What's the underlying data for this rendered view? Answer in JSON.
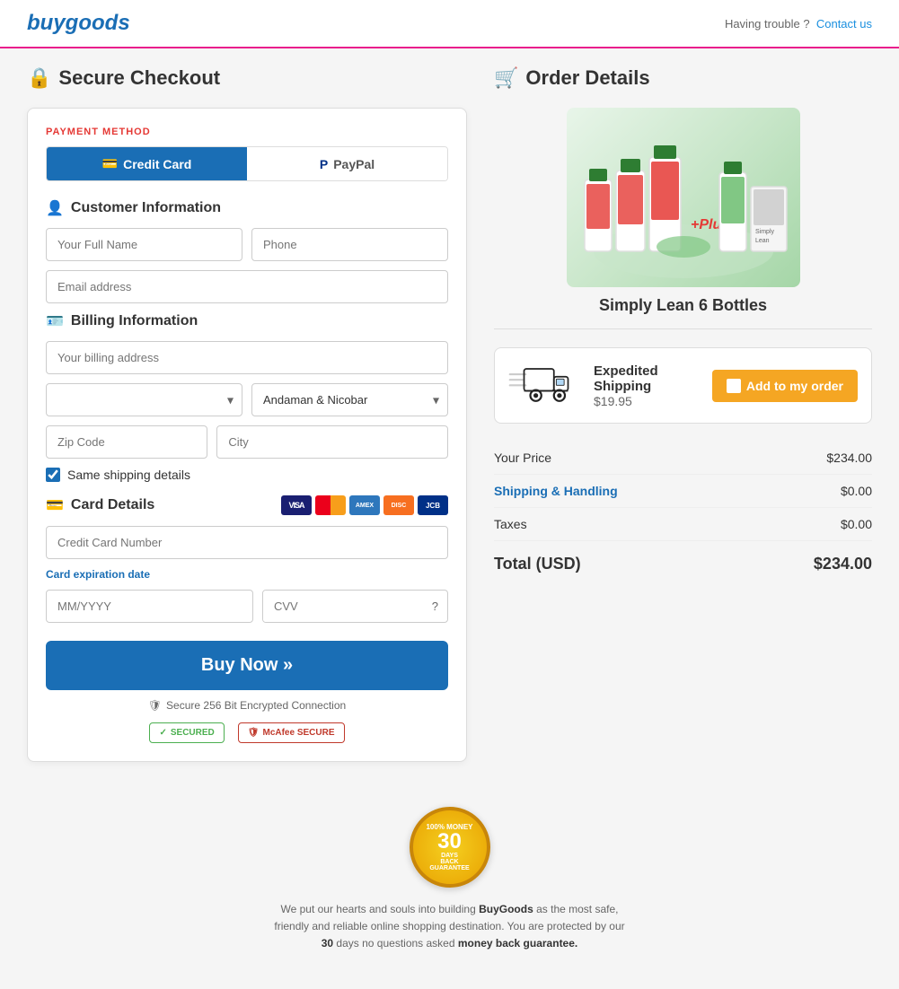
{
  "header": {
    "logo": "buygoods",
    "trouble_text": "Having trouble ?",
    "contact_link": "Contact us"
  },
  "page": {
    "checkout_title": "Secure Checkout",
    "order_title": "Order Details"
  },
  "payment": {
    "section_label": "PAYMENT METHOD",
    "credit_card_tab": "Credit Card",
    "paypal_tab": "PayPal"
  },
  "customer_info": {
    "title": "Customer Information",
    "name_placeholder": "Your Full Name",
    "phone_placeholder": "Phone",
    "email_placeholder": "Email address"
  },
  "billing": {
    "title": "Billing Information",
    "address_placeholder": "Your billing address",
    "country_placeholder": "",
    "state_value": "Andaman & Nicobar",
    "zip_placeholder": "Zip Code",
    "city_placeholder": "City",
    "same_shipping_label": "Same shipping details"
  },
  "card_details": {
    "title": "Card Details",
    "card_number_placeholder": "Credit Card Number",
    "expiry_label": "Card expiration date",
    "expiry_placeholder": "MM/YYYY",
    "cvv_placeholder": "CVV"
  },
  "buy_button": {
    "label": "Buy Now »"
  },
  "secure": {
    "text": "Secure 256 Bit Encrypted Connection",
    "badge1": "SECURED",
    "badge2": "McAfee SECURE"
  },
  "order": {
    "product_name": "Simply Lean 6 Bottles",
    "shipping": {
      "title": "Expedited Shipping",
      "price": "$19.95",
      "button_label": "Add to my order"
    },
    "price_rows": [
      {
        "label": "Your Price",
        "value": "$234.00",
        "highlighted": false
      },
      {
        "label": "Shipping & Handling",
        "value": "$0.00",
        "highlighted": true
      },
      {
        "label": "Taxes",
        "value": "$0.00",
        "highlighted": false
      }
    ],
    "total_label": "Total (USD)",
    "total_value": "$234.00"
  },
  "footer": {
    "guarantee_top": "100% MONEY",
    "guarantee_days": "30",
    "guarantee_label": "DAYS",
    "guarantee_bottom": "BACK GUARANTEE",
    "text_part1": "We put our hearts and souls into building ",
    "brand": "BuyGoods",
    "text_part2": " as the most safe, friendly and reliable online shopping destination. You are protected by our ",
    "days_bold": "30",
    "text_part3": " days no questions asked ",
    "guarantee_text": "money back guarantee."
  },
  "icons": {
    "lock": "🔒",
    "person": "👤",
    "cart": "🛒",
    "id_card": "🪪",
    "credit_card": "💳",
    "shield": "🛡",
    "paypal": "Ⓟ"
  }
}
